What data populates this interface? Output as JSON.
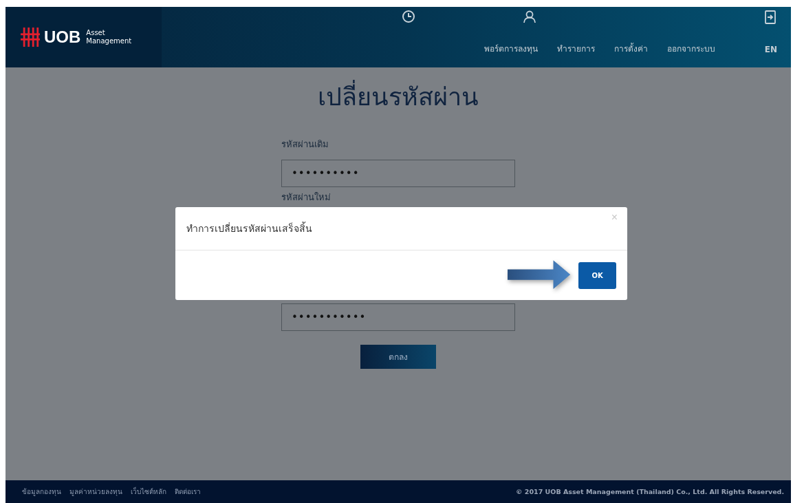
{
  "header": {
    "logo": {
      "mark": "UOB",
      "subtitle_1": "Asset",
      "subtitle_2": "Management"
    },
    "nav": [
      {
        "label": "พอร์ตการลงทุน"
      },
      {
        "label": "ทำรายการ"
      },
      {
        "label": "การตั้งค่า"
      },
      {
        "label": "ออกจากระบบ"
      },
      {
        "label": "EN"
      }
    ]
  },
  "page": {
    "title": "เปลี่ยนรหัสผ่าน",
    "fields": [
      {
        "label": "รหัสผ่านเดิม",
        "value": "••••••••••"
      },
      {
        "label": "รหัสผ่านใหม่"
      },
      {
        "value": "•••••••••••"
      }
    ],
    "submit": "ตกลง"
  },
  "dialog": {
    "message": "ทำการเปลี่ยนรหัสผ่านเสร็จสิ้น",
    "close": "×",
    "ok": "OK"
  },
  "footer": {
    "links": [
      "ข้อมูลกองทุน",
      "มูลค่าหน่วยลงทุน",
      "เว็บไซต์หลัก",
      "ติดต่อเรา"
    ],
    "copyright": "© 2017 UOB Asset Management (Thailand) Co., Ltd. All Rights Reserved."
  }
}
